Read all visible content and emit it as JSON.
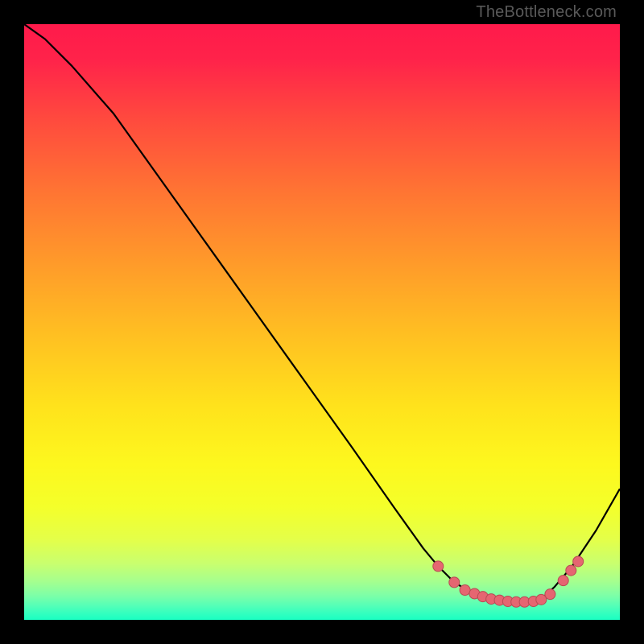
{
  "watermark": "TheBottleneck.com",
  "colors": {
    "curve": "#000000",
    "markers_fill": "#e56671",
    "markers_stroke": "#b84a54",
    "bg_black": "#000000"
  },
  "gradient_stops": [
    {
      "offset": 0.0,
      "color": "#ff1a4b"
    },
    {
      "offset": 0.06,
      "color": "#ff234a"
    },
    {
      "offset": 0.16,
      "color": "#ff4a3e"
    },
    {
      "offset": 0.28,
      "color": "#ff7433"
    },
    {
      "offset": 0.4,
      "color": "#ff9a2a"
    },
    {
      "offset": 0.52,
      "color": "#ffbf22"
    },
    {
      "offset": 0.64,
      "color": "#ffe21c"
    },
    {
      "offset": 0.74,
      "color": "#fdf81e"
    },
    {
      "offset": 0.81,
      "color": "#f4ff2a"
    },
    {
      "offset": 0.865,
      "color": "#e4ff49"
    },
    {
      "offset": 0.905,
      "color": "#c9ff6e"
    },
    {
      "offset": 0.935,
      "color": "#a6ff8e"
    },
    {
      "offset": 0.958,
      "color": "#7fffa6"
    },
    {
      "offset": 0.975,
      "color": "#58ffb6"
    },
    {
      "offset": 0.988,
      "color": "#36ffbe"
    },
    {
      "offset": 1.0,
      "color": "#19ffc2"
    }
  ],
  "chart_data": {
    "type": "line",
    "title": "",
    "xlabel": "",
    "ylabel": "",
    "xlim": [
      0,
      100
    ],
    "ylim": [
      0,
      100
    ],
    "series": [
      {
        "name": "bottleneck-curve",
        "x": [
          0,
          3.5,
          8,
          15,
          25,
          35,
          45,
          55,
          62,
          67,
          69.5,
          72,
          75,
          78,
          81,
          83.5,
          85.5,
          87,
          89,
          92,
          96,
          100
        ],
        "y": [
          100,
          97.5,
          93,
          85,
          71,
          57,
          43,
          29,
          19,
          12,
          9,
          6.5,
          4.5,
          3.4,
          3.0,
          3.0,
          3.2,
          3.7,
          5.5,
          9,
          15,
          22
        ]
      }
    ],
    "markers": {
      "name": "highlight-cluster",
      "x": [
        69.5,
        72.2,
        74.0,
        75.6,
        77.0,
        78.4,
        79.8,
        81.2,
        82.6,
        84.0,
        85.5,
        86.8,
        88.3,
        90.5,
        91.8,
        93.0
      ],
      "y": [
        9.0,
        6.3,
        5.0,
        4.4,
        3.9,
        3.5,
        3.3,
        3.1,
        3.0,
        3.0,
        3.1,
        3.4,
        4.3,
        6.6,
        8.3,
        9.8
      ]
    }
  }
}
